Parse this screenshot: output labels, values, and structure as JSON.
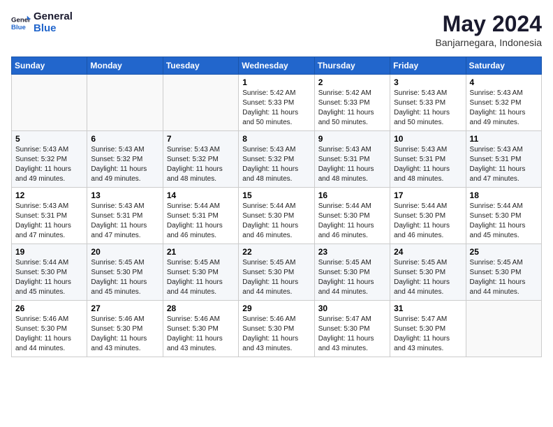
{
  "logo": {
    "line1": "General",
    "line2": "Blue"
  },
  "title": "May 2024",
  "location": "Banjarnegara, Indonesia",
  "days_header": [
    "Sunday",
    "Monday",
    "Tuesday",
    "Wednesday",
    "Thursday",
    "Friday",
    "Saturday"
  ],
  "weeks": [
    [
      {
        "day": "",
        "info": ""
      },
      {
        "day": "",
        "info": ""
      },
      {
        "day": "",
        "info": ""
      },
      {
        "day": "1",
        "info": "Sunrise: 5:42 AM\nSunset: 5:33 PM\nDaylight: 11 hours\nand 50 minutes."
      },
      {
        "day": "2",
        "info": "Sunrise: 5:42 AM\nSunset: 5:33 PM\nDaylight: 11 hours\nand 50 minutes."
      },
      {
        "day": "3",
        "info": "Sunrise: 5:43 AM\nSunset: 5:33 PM\nDaylight: 11 hours\nand 50 minutes."
      },
      {
        "day": "4",
        "info": "Sunrise: 5:43 AM\nSunset: 5:32 PM\nDaylight: 11 hours\nand 49 minutes."
      }
    ],
    [
      {
        "day": "5",
        "info": "Sunrise: 5:43 AM\nSunset: 5:32 PM\nDaylight: 11 hours\nand 49 minutes."
      },
      {
        "day": "6",
        "info": "Sunrise: 5:43 AM\nSunset: 5:32 PM\nDaylight: 11 hours\nand 49 minutes."
      },
      {
        "day": "7",
        "info": "Sunrise: 5:43 AM\nSunset: 5:32 PM\nDaylight: 11 hours\nand 48 minutes."
      },
      {
        "day": "8",
        "info": "Sunrise: 5:43 AM\nSunset: 5:32 PM\nDaylight: 11 hours\nand 48 minutes."
      },
      {
        "day": "9",
        "info": "Sunrise: 5:43 AM\nSunset: 5:31 PM\nDaylight: 11 hours\nand 48 minutes."
      },
      {
        "day": "10",
        "info": "Sunrise: 5:43 AM\nSunset: 5:31 PM\nDaylight: 11 hours\nand 48 minutes."
      },
      {
        "day": "11",
        "info": "Sunrise: 5:43 AM\nSunset: 5:31 PM\nDaylight: 11 hours\nand 47 minutes."
      }
    ],
    [
      {
        "day": "12",
        "info": "Sunrise: 5:43 AM\nSunset: 5:31 PM\nDaylight: 11 hours\nand 47 minutes."
      },
      {
        "day": "13",
        "info": "Sunrise: 5:43 AM\nSunset: 5:31 PM\nDaylight: 11 hours\nand 47 minutes."
      },
      {
        "day": "14",
        "info": "Sunrise: 5:44 AM\nSunset: 5:31 PM\nDaylight: 11 hours\nand 46 minutes."
      },
      {
        "day": "15",
        "info": "Sunrise: 5:44 AM\nSunset: 5:30 PM\nDaylight: 11 hours\nand 46 minutes."
      },
      {
        "day": "16",
        "info": "Sunrise: 5:44 AM\nSunset: 5:30 PM\nDaylight: 11 hours\nand 46 minutes."
      },
      {
        "day": "17",
        "info": "Sunrise: 5:44 AM\nSunset: 5:30 PM\nDaylight: 11 hours\nand 46 minutes."
      },
      {
        "day": "18",
        "info": "Sunrise: 5:44 AM\nSunset: 5:30 PM\nDaylight: 11 hours\nand 45 minutes."
      }
    ],
    [
      {
        "day": "19",
        "info": "Sunrise: 5:44 AM\nSunset: 5:30 PM\nDaylight: 11 hours\nand 45 minutes."
      },
      {
        "day": "20",
        "info": "Sunrise: 5:45 AM\nSunset: 5:30 PM\nDaylight: 11 hours\nand 45 minutes."
      },
      {
        "day": "21",
        "info": "Sunrise: 5:45 AM\nSunset: 5:30 PM\nDaylight: 11 hours\nand 44 minutes."
      },
      {
        "day": "22",
        "info": "Sunrise: 5:45 AM\nSunset: 5:30 PM\nDaylight: 11 hours\nand 44 minutes."
      },
      {
        "day": "23",
        "info": "Sunrise: 5:45 AM\nSunset: 5:30 PM\nDaylight: 11 hours\nand 44 minutes."
      },
      {
        "day": "24",
        "info": "Sunrise: 5:45 AM\nSunset: 5:30 PM\nDaylight: 11 hours\nand 44 minutes."
      },
      {
        "day": "25",
        "info": "Sunrise: 5:45 AM\nSunset: 5:30 PM\nDaylight: 11 hours\nand 44 minutes."
      }
    ],
    [
      {
        "day": "26",
        "info": "Sunrise: 5:46 AM\nSunset: 5:30 PM\nDaylight: 11 hours\nand 44 minutes."
      },
      {
        "day": "27",
        "info": "Sunrise: 5:46 AM\nSunset: 5:30 PM\nDaylight: 11 hours\nand 43 minutes."
      },
      {
        "day": "28",
        "info": "Sunrise: 5:46 AM\nSunset: 5:30 PM\nDaylight: 11 hours\nand 43 minutes."
      },
      {
        "day": "29",
        "info": "Sunrise: 5:46 AM\nSunset: 5:30 PM\nDaylight: 11 hours\nand 43 minutes."
      },
      {
        "day": "30",
        "info": "Sunrise: 5:47 AM\nSunset: 5:30 PM\nDaylight: 11 hours\nand 43 minutes."
      },
      {
        "day": "31",
        "info": "Sunrise: 5:47 AM\nSunset: 5:30 PM\nDaylight: 11 hours\nand 43 minutes."
      },
      {
        "day": "",
        "info": ""
      }
    ]
  ]
}
